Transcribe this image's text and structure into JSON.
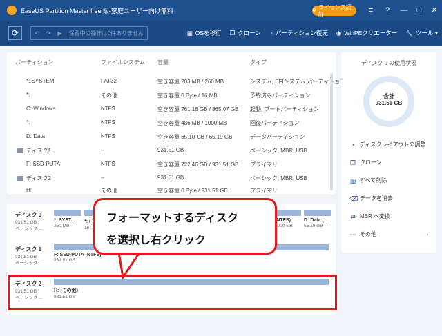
{
  "window": {
    "title": "EaseUS Partition Master free 販-家庭ユーザー向け無料",
    "license_label": "ライセンス認証",
    "controls": [
      "≡",
      "?",
      "—",
      "□",
      "✕"
    ]
  },
  "toolbar": {
    "refresh_icon": "refresh-icon",
    "pending_label": "保留中の操作は0件ありません",
    "actions": [
      {
        "label": "OSを移行",
        "icon": "grid-icon"
      },
      {
        "label": "クローン",
        "icon": "clone-icon"
      },
      {
        "label": "パーティション復元",
        "icon": "restore-icon"
      },
      {
        "label": "WinPEクリエーター",
        "icon": "winpe-icon"
      },
      {
        "label": "ツール ▾",
        "icon": "wrench-icon"
      }
    ]
  },
  "partition_table": {
    "headers": [
      "パーティション",
      "ファイルシステム",
      "容量",
      "タイプ"
    ],
    "rows": [
      {
        "name": "*: SYSTEM",
        "fs": "FAT32",
        "capacity": "空き容量 203 MB / 260 MB",
        "type": "システム, EFIシステム パーティション",
        "disk": false
      },
      {
        "name": "*:",
        "fs": "その他",
        "capacity": "空き容量 0 Byte / 16 MB",
        "type": "予約済みパーティション",
        "disk": false
      },
      {
        "name": "C: Windows",
        "fs": "NTFS",
        "capacity": "空き容量 761.16 GB / 865.07 GB",
        "type": "起動, ブートパーティション",
        "disk": false
      },
      {
        "name": "*:",
        "fs": "NTFS",
        "capacity": "空き容量 486 MB / 1000 MB",
        "type": "回復パーティション",
        "disk": false
      },
      {
        "name": "D: Data",
        "fs": "NTFS",
        "capacity": "空き容量 65.10 GB / 65.19 GB",
        "type": "データパーティション",
        "disk": false
      },
      {
        "name": "ディスク1",
        "fs": "--",
        "capacity": "931.51 GB",
        "type": "ベーシック, MBR, USB",
        "disk": true
      },
      {
        "name": "F: SSD-PUTA",
        "fs": "NTFS",
        "capacity": "空き容量 722.46 GB / 931.51 GB",
        "type": "プライマリ",
        "disk": false
      },
      {
        "name": "ディスク2",
        "fs": "--",
        "capacity": "931.51 GB",
        "type": "ベーシック, MBR, USB",
        "disk": true
      },
      {
        "name": "H:",
        "fs": "その他",
        "capacity": "空き容量 0 Byte / 931.51 GB",
        "type": "プライマリ",
        "disk": false
      }
    ]
  },
  "side_panel": {
    "title": "ディスク 0 の使用状況",
    "total_label": "合計",
    "total_value": "931.51 GB",
    "items": [
      {
        "label": "ディスクレイアウトの調整",
        "icon": "layout-icon"
      },
      {
        "label": "クローン",
        "icon": "clone-icon"
      },
      {
        "label": "すべて削除",
        "icon": "trash-icon"
      },
      {
        "label": "データを消去",
        "icon": "erase-icon"
      },
      {
        "label": "MBR へ変換",
        "icon": "convert-icon"
      },
      {
        "label": "その他",
        "icon": "more-icon"
      }
    ],
    "more_chevron": "›"
  },
  "disk_map": {
    "disks": [
      {
        "label": "ディスク 0",
        "size": "931.51 GB",
        "kind": "ベーシック ...",
        "parts": [
          {
            "name": "*: SYST...",
            "size": "260 MB"
          },
          {
            "name": "*: (そ...",
            "size": "16 ..."
          },
          {
            "name": "(NTFS)",
            "size": "1000 MB"
          },
          {
            "name": "D: Data (...",
            "size": "65.19 GB"
          }
        ]
      },
      {
        "label": "ディスク 1",
        "size": "931.51 GB",
        "kind": "ベーシック ...",
        "parts": [
          {
            "name": "F: SSD-PUTA (NTFS)",
            "size": "931.51 GB"
          }
        ]
      },
      {
        "label": "ディスク 2",
        "size": "931.51 GB",
        "kind": "ベーシック ...",
        "parts": [
          {
            "name": "H: (その他)",
            "size": "931.51 GB"
          }
        ]
      }
    ]
  },
  "callout": {
    "line1": "フォーマットするディスク",
    "line2": "を選択し右クリック"
  }
}
